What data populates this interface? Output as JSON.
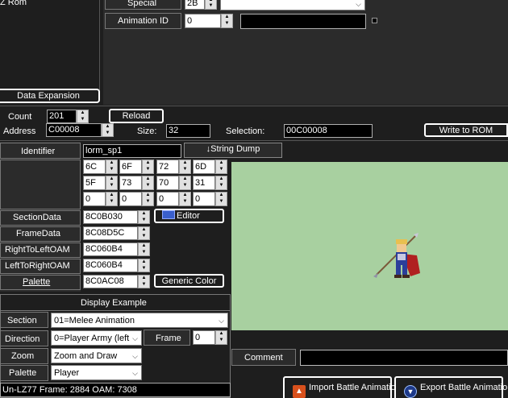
{
  "top": {
    "list_item_text": "Z Rom",
    "data_expansion_label": "Data Expansion",
    "special_label": "Special",
    "special_value": "2B",
    "animation_id_label": "Animation ID",
    "animation_id_value": "0"
  },
  "toolbar": {
    "count_label": "Count",
    "count_value": "201",
    "reload_label": "Reload",
    "address_label": "Address",
    "address_value": "C00008",
    "size_label": "Size:",
    "size_value": "32",
    "selection_label": "Selection:",
    "selection_value": "00C00008",
    "write_label": "Write to ROM"
  },
  "fields": {
    "identifier_label": "Identifier",
    "identifier_value": "lorm_sp1",
    "string_dump_label": "↓String Dump",
    "bytes": [
      [
        "6C",
        "6F",
        "72",
        "6D"
      ],
      [
        "5F",
        "73",
        "70",
        "31"
      ],
      [
        "0",
        "0",
        "0",
        "0"
      ]
    ],
    "section_data_label": "SectionData",
    "section_data_value": "8C0B030",
    "editor_label": "Editor",
    "frame_data_label": "FrameData",
    "frame_data_value": "8C08D5C",
    "rtl_label": "RightToLeftOAM",
    "rtl_value": "8C060B4",
    "ltr_label": "LeftToRightOAM",
    "ltr_value": "8C060B4",
    "palette_label": "Palette",
    "palette_value": "8C0AC08",
    "generic_color_label": "Generic Color"
  },
  "display": {
    "title": "Display Example",
    "section_label": "Section",
    "section_value": "01=Melee Animation",
    "direction_label": "Direction",
    "direction_value": "0=Player Army (left",
    "frame_label": "Frame",
    "frame_value": "0",
    "zoom_label": "Zoom",
    "zoom_value": "Zoom and Draw",
    "palette_label": "Palette",
    "palette_value": "Player",
    "status_text": "Un-LZ77 Frame: 2884 OAM: 7308"
  },
  "preview": {
    "background_color": "#a8d0a0",
    "comment_label": "Comment",
    "comment_value": ""
  },
  "bottom": {
    "import_label": "Import Battle Animation",
    "export_label": "Export Battle Animation"
  }
}
